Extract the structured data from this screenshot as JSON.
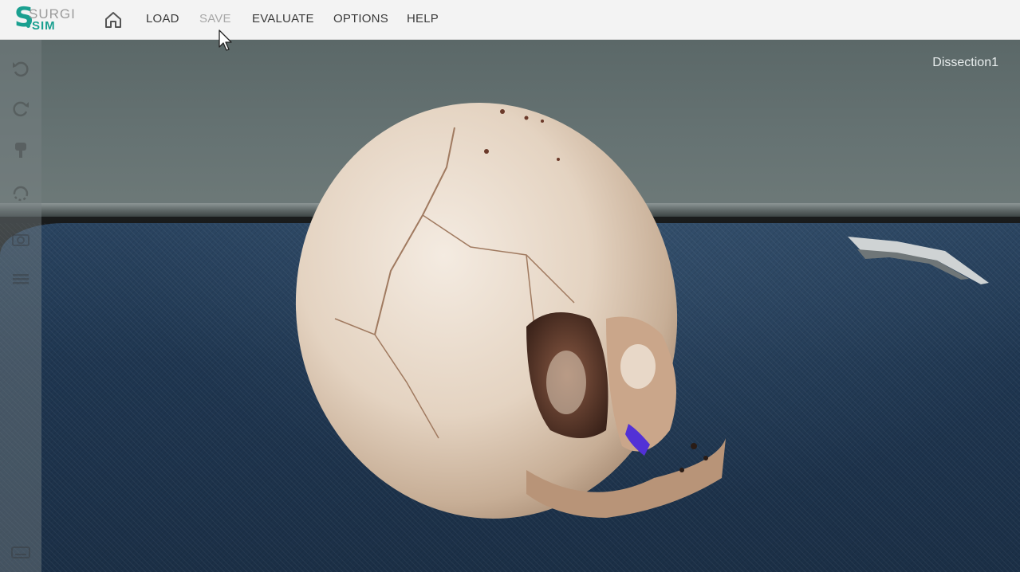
{
  "app": {
    "logo": {
      "mark": "S",
      "line1": "SURGI",
      "line2": "SIM"
    }
  },
  "menubar": {
    "home_icon": "home-icon",
    "items": [
      {
        "label": "LOAD",
        "enabled": true
      },
      {
        "label": "SAVE",
        "enabled": false
      },
      {
        "label": "EVALUATE",
        "enabled": true
      },
      {
        "label": "OPTIONS",
        "enabled": true
      },
      {
        "label": "HELP",
        "enabled": true
      }
    ]
  },
  "viewport": {
    "session_name": "Dissection1"
  },
  "toolbar": {
    "icons": [
      "undo-icon",
      "redo-icon",
      "drill-icon",
      "reset-view-icon",
      "camera-icon",
      "menu-icon",
      "keyboard-icon"
    ]
  },
  "colors": {
    "accent": "#1aa090",
    "menubar_bg": "#f3f3f3",
    "menu_text": "#3a3a3a",
    "menu_disabled": "#a8a8a8",
    "drape": "#1f3650",
    "bone": "#e6d6c4"
  }
}
